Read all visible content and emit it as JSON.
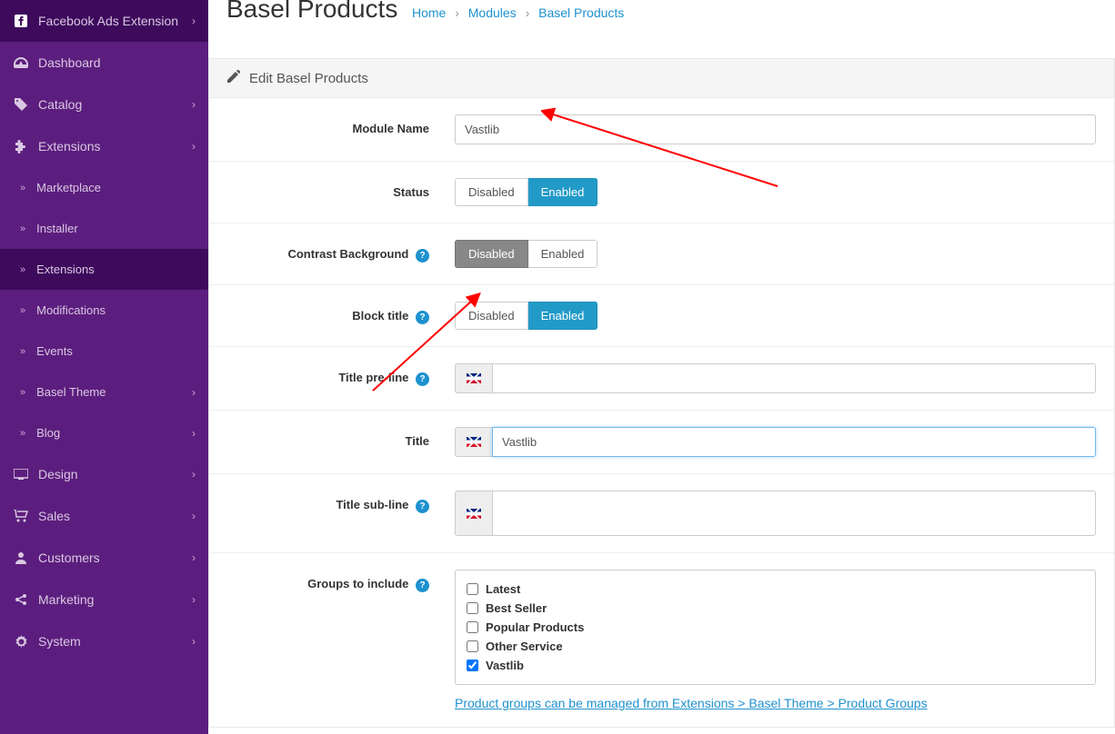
{
  "sidebar": {
    "fbAds": "Facebook Ads Extension",
    "dashboard": "Dashboard",
    "catalog": "Catalog",
    "extensions": "Extensions",
    "marketplace": "Marketplace",
    "installer": "Installer",
    "extensionsSub": "Extensions",
    "modifications": "Modifications",
    "events": "Events",
    "baselTheme": "Basel Theme",
    "blog": "Blog",
    "design": "Design",
    "sales": "Sales",
    "customers": "Customers",
    "marketing": "Marketing",
    "system": "System"
  },
  "header": {
    "title": "Basel Products",
    "bc1": "Home",
    "bc2": "Modules",
    "bc3": "Basel Products"
  },
  "panel": {
    "heading": "Edit Basel Products"
  },
  "form": {
    "moduleNameLabel": "Module Name",
    "moduleNameValue": "Vastlib",
    "statusLabel": "Status",
    "disabled": "Disabled",
    "enabled": "Enabled",
    "contrastLabel": "Contrast Background",
    "blockTitleLabel": "Block title",
    "titlePreLabel": "Title pre-line",
    "titleLabel": "Title",
    "titleValue": "Vastlib",
    "titleSubLabel": "Title sub-line",
    "groupsLabel": "Groups to include",
    "groups": [
      "Latest",
      "Best Seller",
      "Popular Products",
      "Other Service",
      "Vastlib"
    ],
    "hint": "Product groups can be managed from Extensions > Basel Theme > Product Groups"
  }
}
